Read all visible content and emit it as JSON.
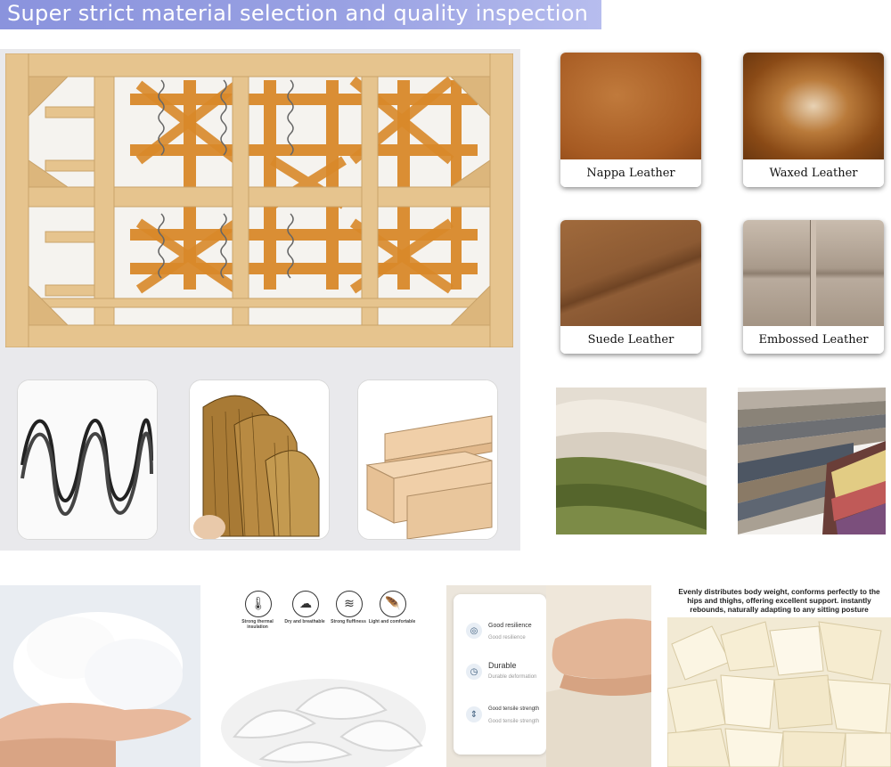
{
  "header": {
    "title": "Super strict material selection and quality inspection"
  },
  "leathers": [
    {
      "label": "Nappa Leather",
      "color": "#b0652a"
    },
    {
      "label": "Waxed Leather",
      "color": "#a85a1e"
    },
    {
      "label": "Suede Leather",
      "color": "#8c5a33"
    },
    {
      "label": "Embossed Leather",
      "color": "#b7a999"
    }
  ],
  "feather": {
    "icons": [
      {
        "icon": "thermometer-icon",
        "caption": "Strong thermal insulation"
      },
      {
        "icon": "breathable-icon",
        "caption": "Dry and breathable"
      },
      {
        "icon": "fluffiness-icon",
        "caption": "Strong fluffiness"
      },
      {
        "icon": "feather-icon",
        "caption": "Light and comfortable"
      }
    ]
  },
  "foam_specs": [
    {
      "icon": "resilience-icon",
      "title": "Good resilience",
      "sub": "Good resilience"
    },
    {
      "icon": "clock-icon",
      "title": "Durable",
      "sub": "Durable deformation"
    },
    {
      "icon": "strength-icon",
      "title": "Good tensile strength",
      "sub": "Good tensile strength"
    }
  ],
  "sponge_caption": "Evenly distributes body weight, conforms perfectly to the hips and thighs, offering excellent support. instantly rebounds, naturally adapting to any sitting posture",
  "colors": {
    "title_bar": "#8a93dd",
    "panel": "#e9e9ec",
    "pine_wood": "#e6c48e",
    "webbing": "#d9892a"
  }
}
